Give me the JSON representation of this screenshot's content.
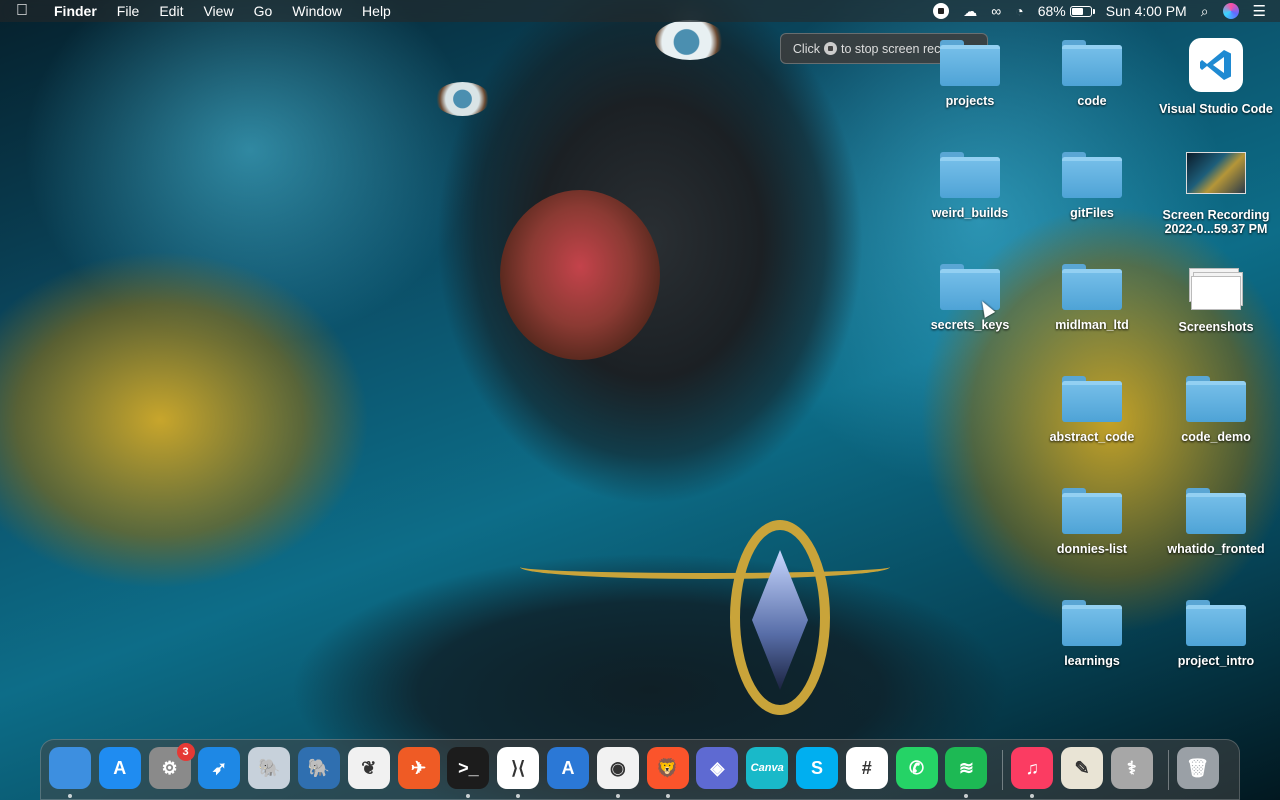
{
  "menubar": {
    "apple_icon": "apple-icon",
    "app_name": "Finder",
    "menus": [
      "File",
      "Edit",
      "View",
      "Go",
      "Window",
      "Help"
    ],
    "battery_percent": "68%",
    "battery_level": 0.68,
    "clock": "Sun 4:00 PM"
  },
  "tooltip": {
    "text_before": "Click",
    "text_after": "to stop screen recording"
  },
  "desktop": {
    "icons": [
      {
        "label": "projects",
        "type": "folder"
      },
      {
        "label": "code",
        "type": "folder"
      },
      {
        "label": "Visual Studio Code",
        "type": "app"
      },
      {
        "label": "weird_builds",
        "type": "folder"
      },
      {
        "label": "gitFiles",
        "type": "folder"
      },
      {
        "label": "Screen Recording 2022-0...59.37 PM",
        "type": "video"
      },
      {
        "label": "secrets_keys",
        "type": "folder"
      },
      {
        "label": "midlman_ltd",
        "type": "folder"
      },
      {
        "label": "Screenshots",
        "type": "stack"
      },
      {
        "label": "abstract_code",
        "type": "folder"
      },
      {
        "label": "code_demo",
        "type": "folder"
      },
      {
        "label": "donnies-list",
        "type": "folder"
      },
      {
        "label": "whatido_fronted",
        "type": "folder"
      },
      {
        "label": "learnings",
        "type": "folder"
      },
      {
        "label": "project_intro",
        "type": "folder"
      }
    ]
  },
  "dock": {
    "items": [
      {
        "name": "finder-icon",
        "glyph": "",
        "color": "#3d8fe0",
        "running": true
      },
      {
        "name": "app-store-icon",
        "glyph": "A",
        "color": "#1f8cf1",
        "running": false
      },
      {
        "name": "system-preferences-icon",
        "glyph": "⚙",
        "color": "#8a8a8a",
        "running": false,
        "badge": "3"
      },
      {
        "name": "safari-icon",
        "glyph": "➶",
        "color": "#1e88e5",
        "running": false
      },
      {
        "name": "postgres-icon",
        "glyph": "🐘",
        "color": "#c7d1db",
        "running": false
      },
      {
        "name": "pgadmin-icon",
        "glyph": "🐘",
        "color": "#2f6fb0",
        "running": false
      },
      {
        "name": "mongodb-compass-icon",
        "glyph": "❦",
        "color": "#f1f1f1",
        "running": false
      },
      {
        "name": "postman-icon",
        "glyph": "✈",
        "color": "#ef5b25",
        "running": false
      },
      {
        "name": "terminal-icon",
        "glyph": ">_",
        "color": "#1c1c1c",
        "running": true
      },
      {
        "name": "vscode-icon",
        "glyph": "⟩⟨",
        "color": "#ffffff",
        "running": true
      },
      {
        "name": "xcode-icon",
        "glyph": "A",
        "color": "#2b78d6",
        "running": false
      },
      {
        "name": "chrome-icon",
        "glyph": "◉",
        "color": "#f2f2f2",
        "running": true
      },
      {
        "name": "brave-icon",
        "glyph": "🦁",
        "color": "#fb542b",
        "running": true
      },
      {
        "name": "linear-icon",
        "glyph": "◈",
        "color": "#5e6ad2",
        "running": false
      },
      {
        "name": "canva-icon",
        "glyph": "Canva",
        "color": "#19b9c9",
        "running": false
      },
      {
        "name": "skype-icon",
        "glyph": "S",
        "color": "#00aff0",
        "running": false
      },
      {
        "name": "slack-icon",
        "glyph": "#",
        "color": "#ffffff",
        "running": false
      },
      {
        "name": "whatsapp-icon",
        "glyph": "✆",
        "color": "#25d366",
        "running": false
      },
      {
        "name": "spotify-icon",
        "glyph": "≋",
        "color": "#1db954",
        "running": true
      },
      {
        "name": "music-icon",
        "glyph": "♫",
        "color": "#fb3c62",
        "running": true
      },
      {
        "name": "textedit-icon",
        "glyph": "✎",
        "color": "#e9e4d5",
        "running": false
      },
      {
        "name": "preview-icon",
        "glyph": "⚕",
        "color": "#a7a7a7",
        "running": false
      },
      {
        "name": "trash-icon",
        "glyph": "🗑",
        "color": "#9aa0a6",
        "running": false
      }
    ]
  },
  "colors": {
    "folder": "#5aa6d4",
    "badge": "#e53935",
    "menubar_bg": "#282828"
  }
}
